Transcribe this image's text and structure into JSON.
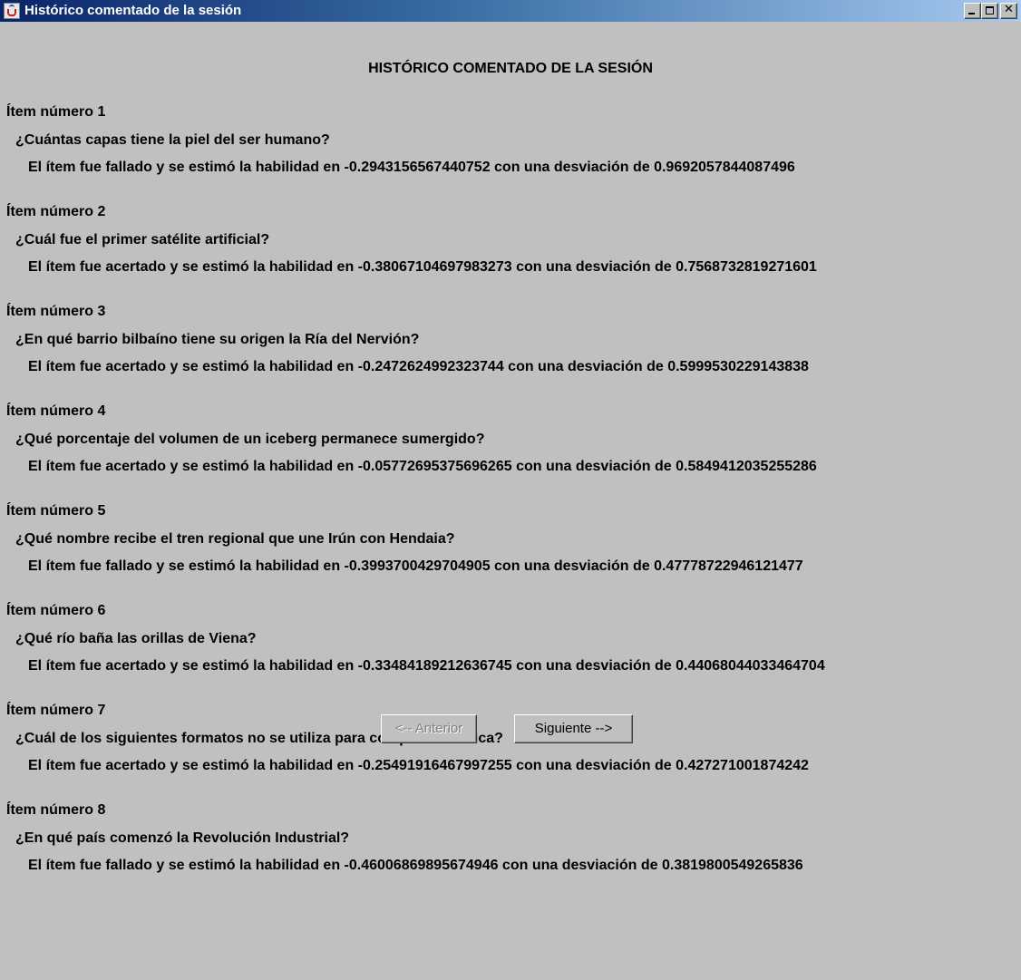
{
  "window": {
    "title": "Histórico comentado de la sesión",
    "icon": "java-cup-icon"
  },
  "heading": "HISTÓRICO COMENTADO DE LA SESIÓN",
  "items": [
    {
      "number": "Ítem número 1",
      "question": "¿Cuántas capas tiene la piel del ser humano?",
      "result": "El ítem fue fallado y se estimó la habilidad en -0.2943156567440752 con una desviación de 0.9692057844087496"
    },
    {
      "number": "Ítem número 2",
      "question": "¿Cuál fue el primer satélite artificial?",
      "result": "El ítem fue acertado y se estimó la habilidad en -0.38067104697983273 con una desviación de 0.7568732819271601"
    },
    {
      "number": "Ítem número 3",
      "question": "¿En qué barrio bilbaíno tiene su origen la Ría del Nervión?",
      "result": "El ítem fue acertado y se estimó la habilidad en -0.2472624992323744 con una desviación de 0.5999530229143838"
    },
    {
      "number": "Ítem número 4",
      "question": "¿Qué porcentaje del volumen de un iceberg permanece sumergido?",
      "result": "El ítem fue acertado y se estimó la habilidad en -0.05772695375696265 con una desviación de 0.5849412035255286"
    },
    {
      "number": "Ítem número 5",
      "question": "¿Qué nombre recibe el tren regional que une Irún con Hendaia?",
      "result": "El ítem fue fallado y se estimó la habilidad en -0.3993700429704905 con una desviación de 0.47778722946121477"
    },
    {
      "number": "Ítem número 6",
      "question": "¿Qué río baña las orillas de Viena?",
      "result": "El ítem fue acertado y se estimó la habilidad en -0.33484189212636745 con una desviación de 0.44068044033464704"
    },
    {
      "number": "Ítem número 7",
      "question": "¿Cuál de los siguientes formatos no se utiliza para comprimir música?",
      "result": "El ítem fue acertado y se estimó la habilidad en -0.25491916467997255 con una desviación de 0.427271001874242"
    },
    {
      "number": "Ítem número 8",
      "question": "¿En qué país comenzó la Revolución Industrial?",
      "result": "El ítem fue fallado y se estimó la habilidad en -0.46006869895674946 con una desviación de 0.3819800549265836"
    }
  ],
  "buttons": {
    "previous": "<-- Anterior",
    "next": "Siguiente -->"
  }
}
